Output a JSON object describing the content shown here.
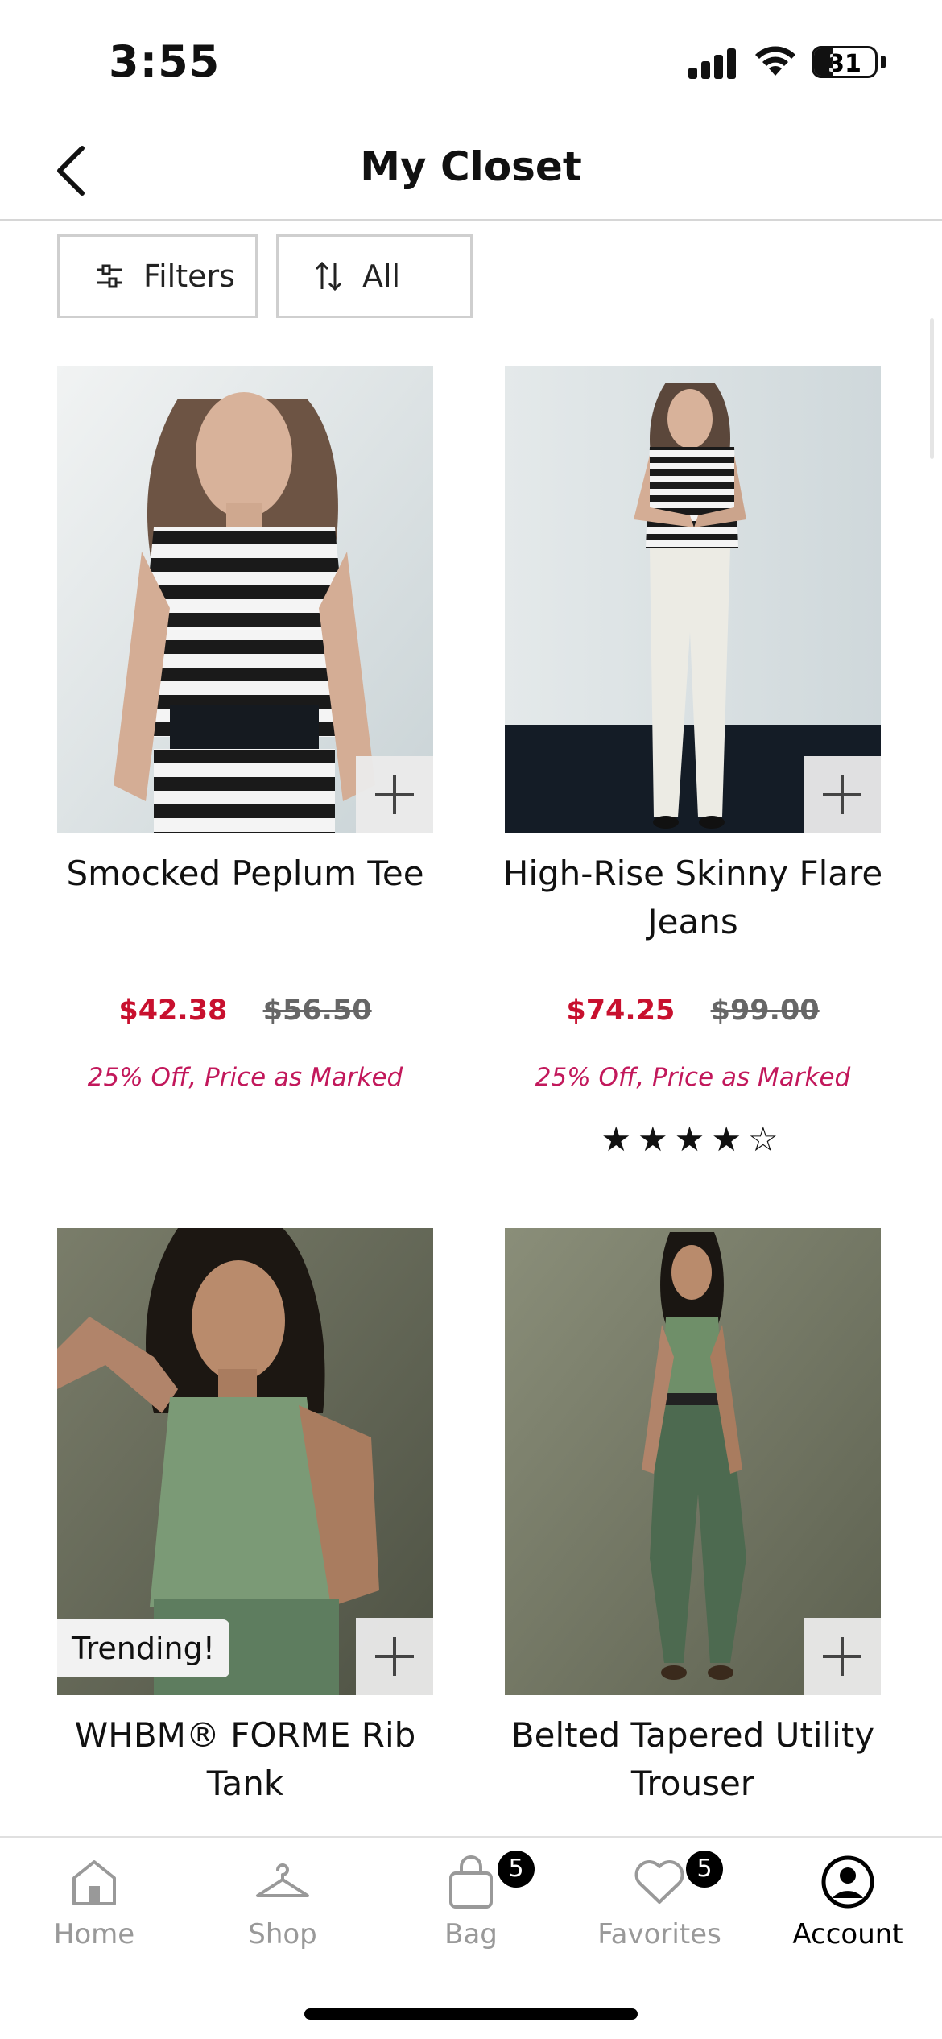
{
  "status_bar": {
    "time": "3:55",
    "battery": "31",
    "battery_level": 0.31
  },
  "header": {
    "title": "My Closet"
  },
  "toolbar": {
    "filters_label": "Filters",
    "sort_label": "All"
  },
  "products": [
    {
      "name": "Smocked Peplum Tee",
      "sale_price": "$42.38",
      "original_price": "$56.50",
      "promo": "25% Off, Price as Marked",
      "badge": "",
      "rating": ""
    },
    {
      "name": "High-Rise Skinny Flare Jeans",
      "sale_price": "$74.25",
      "original_price": "$99.00",
      "promo": "25% Off, Price as Marked",
      "badge": "",
      "rating": "★★★★☆"
    },
    {
      "name": "WHBM® FORME Rib Tank",
      "sale_price": "",
      "original_price": "",
      "promo": "",
      "badge": "Trending!",
      "rating": ""
    },
    {
      "name": "Belted Tapered Utility Trouser",
      "sale_price": "",
      "original_price": "",
      "promo": "",
      "badge": "",
      "rating": ""
    }
  ],
  "bottom_nav": {
    "items": [
      {
        "label": "Home",
        "icon": "home-icon",
        "badge": ""
      },
      {
        "label": "Shop",
        "icon": "hanger-icon",
        "badge": ""
      },
      {
        "label": "Bag",
        "icon": "bag-icon",
        "badge": "5"
      },
      {
        "label": "Favorites",
        "icon": "heart-icon",
        "badge": "5"
      },
      {
        "label": "Account",
        "icon": "account-icon",
        "badge": ""
      }
    ],
    "active": "Account"
  },
  "colors": {
    "sale": "#c8102e",
    "promo": "#c2185b",
    "nav_inactive": "#999999"
  }
}
